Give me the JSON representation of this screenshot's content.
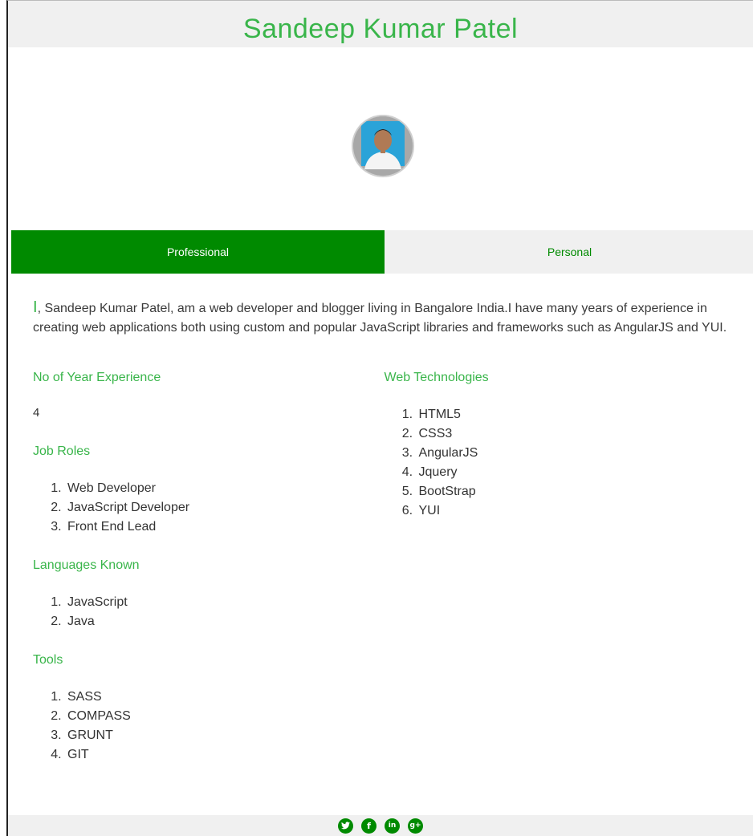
{
  "header": {
    "title": "Sandeep Kumar Patel"
  },
  "tabs": [
    {
      "label": "Professional",
      "active": true
    },
    {
      "label": "Personal",
      "active": false
    }
  ],
  "intro": {
    "first_letter": "I",
    "rest": ", Sandeep Kumar Patel, am a web developer and blogger living in Bangalore India.I have many years of experience in creating web applications both using custom and popular JavaScript libraries and frameworks such as AngularJS and YUI."
  },
  "experience": {
    "title": "No of Year Experience",
    "value": "4"
  },
  "job_roles": {
    "title": "Job Roles",
    "items": [
      "Web Developer",
      "JavaScript Developer",
      "Front End Lead"
    ]
  },
  "languages": {
    "title": "Languages Known",
    "items": [
      "JavaScript",
      "Java"
    ]
  },
  "tools": {
    "title": "Tools",
    "items": [
      "SASS",
      "COMPASS",
      "GRUNT",
      "GIT"
    ]
  },
  "web_technologies": {
    "title": "Web Technologies",
    "items": [
      "HTML5",
      "CSS3",
      "AngularJS",
      "Jquery",
      "BootStrap",
      "YUI"
    ]
  },
  "footer": {
    "social": [
      {
        "icon": "twitter-icon",
        "glyph": "t"
      },
      {
        "icon": "facebook-icon",
        "glyph": "f"
      },
      {
        "icon": "linkedin-icon",
        "glyph": "in"
      },
      {
        "icon": "google-plus-icon",
        "glyph": "g+"
      }
    ]
  },
  "colors": {
    "accent": "#39b54a",
    "tab_active": "#008a00",
    "header_bg": "#f0f0f0"
  }
}
